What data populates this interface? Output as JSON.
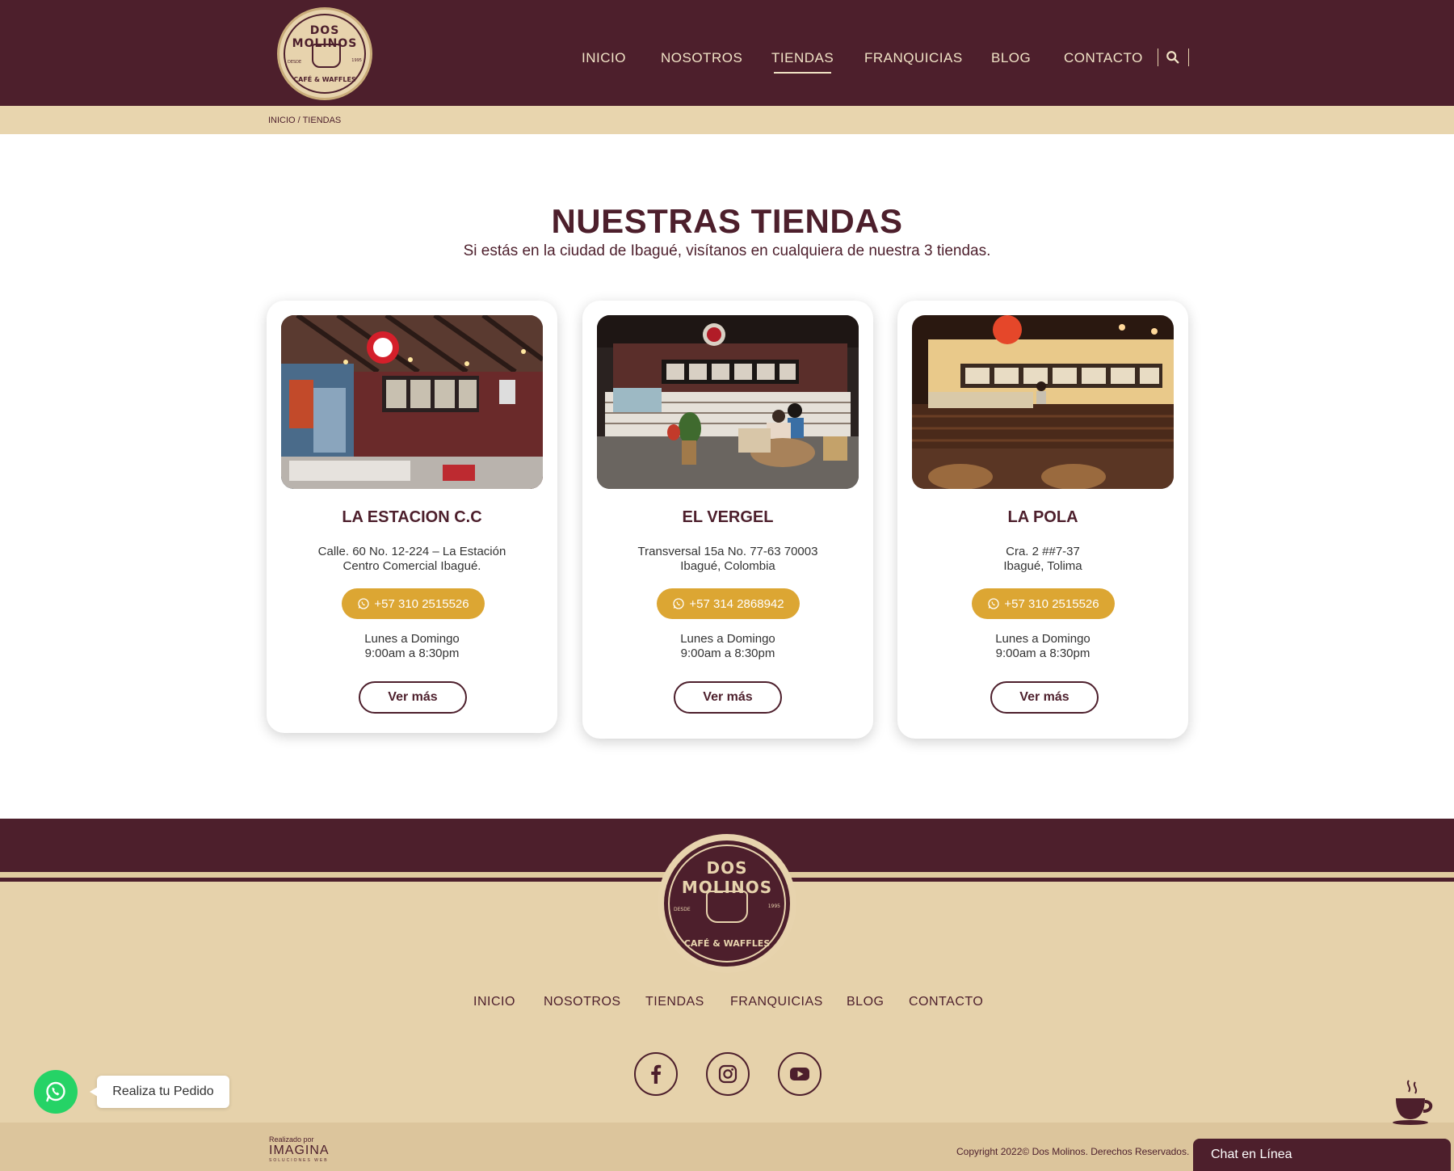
{
  "brand": {
    "logo_top": "DOS MOLINOS",
    "logo_bottom": "CAFÉ & WAFFLES",
    "logo_desde": "DESDE",
    "logo_year": "1995"
  },
  "colors": {
    "primary": "#4d1f2c",
    "cream": "#e8d5ae",
    "accent": "#dca633",
    "whatsapp": "#25d366"
  },
  "nav": {
    "items": [
      {
        "label": "INICIO"
      },
      {
        "label": "NOSOTROS"
      },
      {
        "label": "TIENDAS",
        "active": true
      },
      {
        "label": "FRANQUICIAS"
      },
      {
        "label": "BLOG"
      },
      {
        "label": "CONTACTO"
      }
    ],
    "search_icon": "search-icon"
  },
  "breadcrumb": "INICIO / TIENDAS",
  "main": {
    "title": "NUESTRAS TIENDAS",
    "subtitle": "Si estás en la ciudad de Ibagué, visítanos en cualquiera de nuestra 3 tiendas."
  },
  "stores": [
    {
      "name": "LA ESTACION C.C",
      "address_line1": "Calle. 60 No. 12-224 – La Estación",
      "address_line2": "Centro Comercial Ibagué.",
      "phone": "+57 310 2515526",
      "hours_line1": "Lunes a Domingo",
      "hours_line2": "9:00am a 8:30pm",
      "more": "Ver más"
    },
    {
      "name": "EL VERGEL",
      "address_line1": "Transversal 15a No. 77-63 70003",
      "address_line2": "Ibagué, Colombia",
      "phone": "+57 314 2868942",
      "hours_line1": "Lunes a Domingo",
      "hours_line2": "9:00am a 8:30pm",
      "more": "Ver más"
    },
    {
      "name": "LA POLA",
      "address_line1": "Cra. 2 ##7-37",
      "address_line2": "Ibagué, Tolima",
      "phone": "+57 310 2515526",
      "hours_line1": "Lunes a Domingo",
      "hours_line2": "9:00am a 8:30pm",
      "more": "Ver más"
    }
  ],
  "footer": {
    "nav": [
      "INICIO",
      "NOSOTROS",
      "TIENDAS",
      "FRANQUICIAS",
      "BLOG",
      "CONTACTO"
    ],
    "social": [
      "facebook-icon",
      "instagram-icon",
      "youtube-icon"
    ],
    "credit_small": "Realizado por",
    "credit_brand": "IMAGINA",
    "credit_tag": "SOLUCIONES WEB",
    "copyright": "Copyright 2022© Dos Molinos. Derechos Reservados."
  },
  "widgets": {
    "whatsapp_label": "Realiza tu Pedido",
    "chat_label": "Chat en Línea"
  }
}
